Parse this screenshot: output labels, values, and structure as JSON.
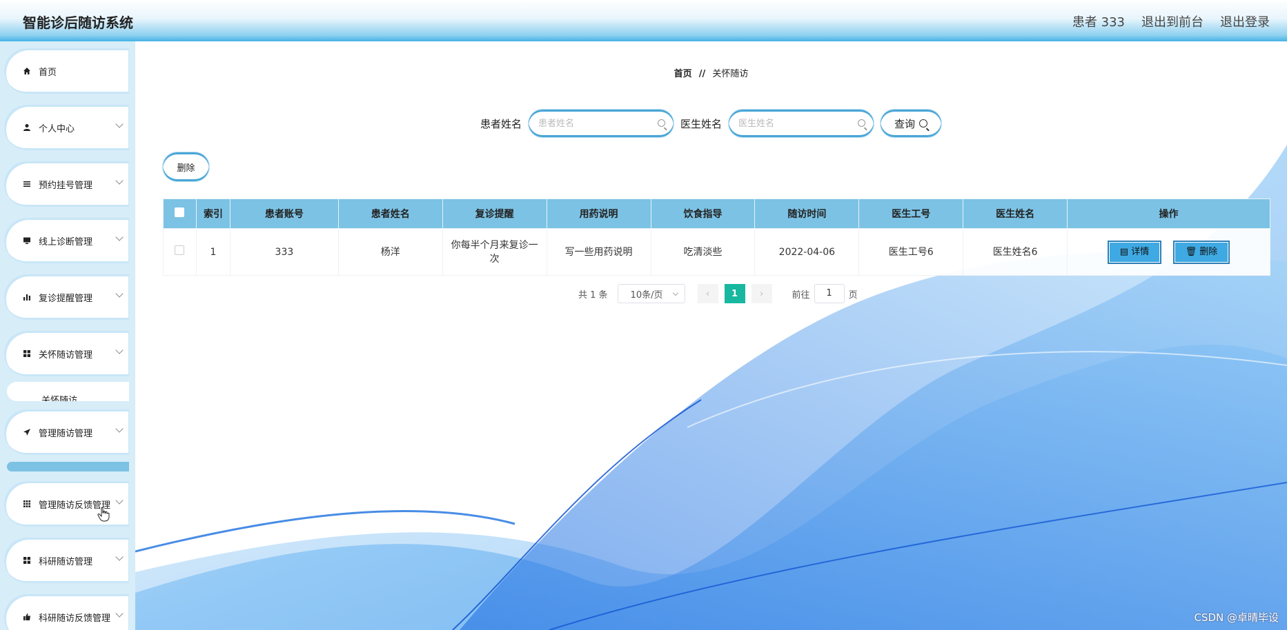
{
  "header": {
    "title": "智能诊后随访系统",
    "user": "患者 333",
    "back_front": "退出到前台",
    "logout": "退出登录"
  },
  "sidebar": {
    "items": [
      {
        "label": "首页",
        "icon": "home-icon"
      },
      {
        "label": "个人中心",
        "icon": "user-icon"
      },
      {
        "label": "预约挂号管理",
        "icon": "list-icon"
      },
      {
        "label": "线上诊断管理",
        "icon": "monitor-icon"
      },
      {
        "label": "复诊提醒管理",
        "icon": "bar-chart-icon"
      },
      {
        "label": "关怀随访管理",
        "icon": "grid-icon"
      },
      {
        "label": "管理随访管理",
        "icon": "send-icon"
      },
      {
        "label": "管理随访反馈管理",
        "icon": "grid9-icon"
      },
      {
        "label": "科研随访管理",
        "icon": "grid-icon"
      },
      {
        "label": "科研随访反馈管理",
        "icon": "thumb-icon"
      }
    ],
    "submenu": {
      "label": "关怀随访"
    }
  },
  "breadcrumb": {
    "home": "首页",
    "separator": "//",
    "current": "关怀随访"
  },
  "search": {
    "patient_label": "患者姓名",
    "patient_placeholder": "患者姓名",
    "doctor_label": "医生姓名",
    "doctor_placeholder": "医生姓名",
    "query_label": "查询"
  },
  "actions": {
    "delete_label": "删除"
  },
  "table": {
    "headers": [
      "索引",
      "患者账号",
      "患者姓名",
      "复诊提醒",
      "用药说明",
      "饮食指导",
      "随访时间",
      "医生工号",
      "医生姓名",
      "操作"
    ],
    "rows": [
      {
        "index": "1",
        "account": "333",
        "patient_name": "杨洋",
        "reminder": "你每半个月来复诊一次",
        "medication": "写一些用药说明",
        "diet": "吃清淡些",
        "time": "2022-04-06",
        "doctor_id": "医生工号6",
        "doctor_name": "医生姓名6",
        "detail_label": "详情",
        "delete_label": "删除"
      }
    ]
  },
  "pagination": {
    "total": "共 1 条",
    "page_size": "10条/页",
    "current_page": "1",
    "goto_label": "前往",
    "goto_value": "1",
    "page_unit": "页"
  },
  "watermark": "CSDN @卓晴毕设",
  "colors": {
    "accent": "#7cc2e4",
    "button": "#3fa9e3",
    "page_active": "#18b7a0"
  }
}
